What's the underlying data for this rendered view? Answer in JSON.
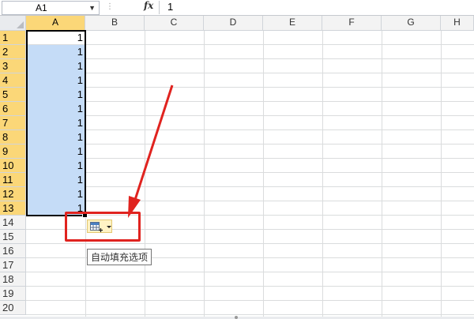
{
  "formula_bar": {
    "name_box": "A1",
    "formula": "1",
    "fx_label": "fx"
  },
  "columns": [
    "A",
    "B",
    "C",
    "D",
    "E",
    "F",
    "G",
    "H"
  ],
  "rows": [
    "1",
    "2",
    "3",
    "4",
    "5",
    "6",
    "7",
    "8",
    "9",
    "10",
    "11",
    "12",
    "13",
    "14",
    "15",
    "16",
    "17",
    "18",
    "19",
    "20"
  ],
  "column_a_values": [
    "1",
    "1",
    "1",
    "1",
    "1",
    "1",
    "1",
    "1",
    "1",
    "1",
    "1",
    "1",
    "1"
  ],
  "autofill": {
    "tooltip": "自动填充选项"
  },
  "colors": {
    "selected_header": "#fbd778",
    "selection_fill": "#c5dcf7",
    "annotation_red": "#e0231f"
  }
}
